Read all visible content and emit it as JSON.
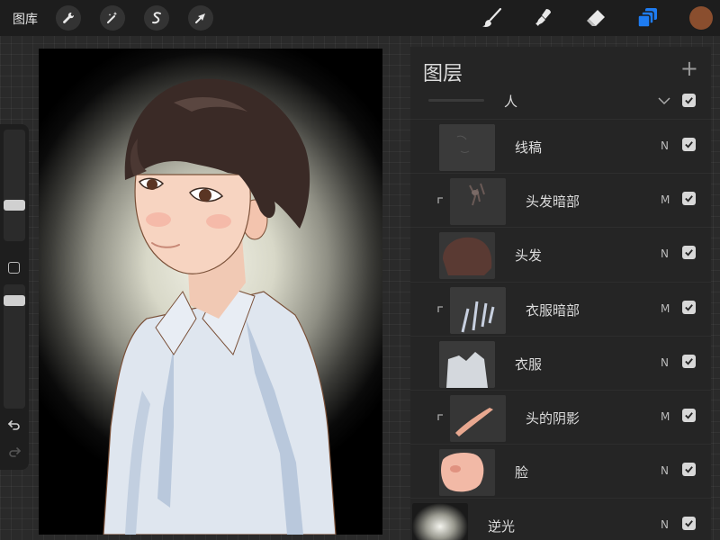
{
  "toolbar": {
    "gallery_label": "图库",
    "left_tools": [
      "wrench-icon",
      "magic-wand-icon",
      "selection-s-icon",
      "transform-arrow-icon"
    ],
    "right_tools": [
      "brush-icon",
      "smudge-icon",
      "eraser-icon",
      "layers-icon"
    ],
    "active_tool": "layers-icon",
    "accent_color": "#1e7cf2",
    "current_color": "#8a4e2e"
  },
  "layers": {
    "title": "图层",
    "add_symbol": "+",
    "group": {
      "name": "人",
      "visible": true
    },
    "items": [
      {
        "name": "线稿",
        "blend": "N",
        "clipped": false,
        "visible": true
      },
      {
        "name": "头发暗部",
        "blend": "M",
        "clipped": true,
        "visible": true
      },
      {
        "name": "头发",
        "blend": "N",
        "clipped": false,
        "visible": true
      },
      {
        "name": "衣服暗部",
        "blend": "M",
        "clipped": true,
        "visible": true
      },
      {
        "name": "衣服",
        "blend": "N",
        "clipped": false,
        "visible": true
      },
      {
        "name": "头的阴影",
        "blend": "M",
        "clipped": true,
        "visible": true
      },
      {
        "name": "脸",
        "blend": "N",
        "clipped": false,
        "visible": true
      },
      {
        "name": "逆光",
        "blend": "N",
        "clipped": false,
        "visible": true
      }
    ]
  }
}
